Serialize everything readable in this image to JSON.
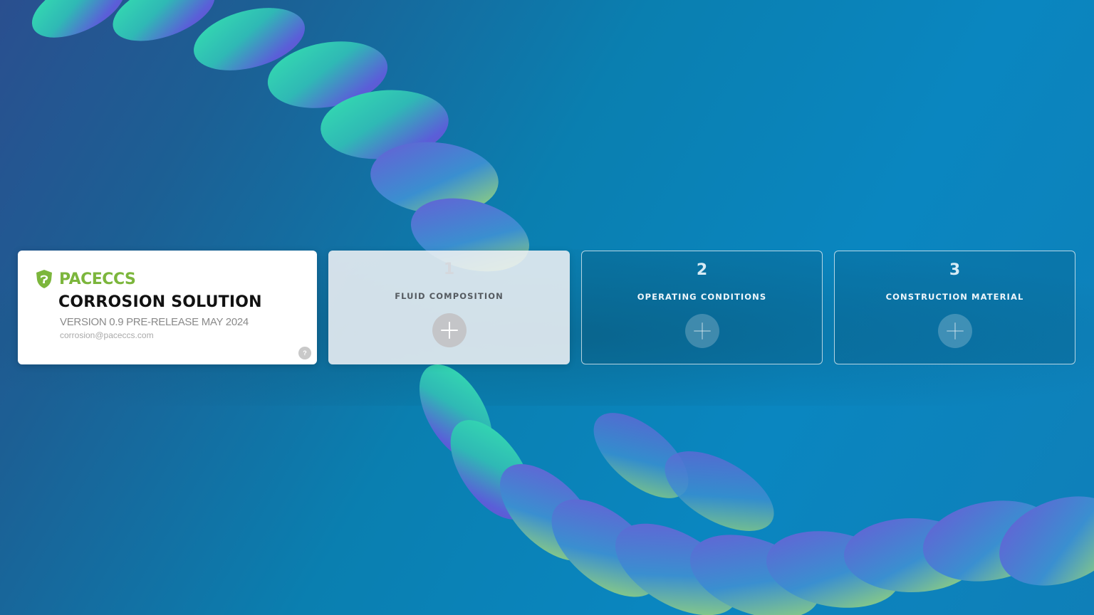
{
  "brand": {
    "name": "PACECCS",
    "app_title": "CORROSION SOLUTION",
    "version": "VERSION 0.9 PRE-RELEASE MAY 2024",
    "email": "corrosion@paceccs.com",
    "help_label": "?"
  },
  "steps": [
    {
      "number": "1",
      "label": "FLUID COMPOSITION",
      "state": "active"
    },
    {
      "number": "2",
      "label": "OPERATING CONDITIONS",
      "state": "inactive"
    },
    {
      "number": "3",
      "label": "CONSTRUCTION MATERIAL",
      "state": "inactive"
    }
  ],
  "colors": {
    "brand_green": "#7cb63c",
    "background_blue": "#0a86c0"
  }
}
